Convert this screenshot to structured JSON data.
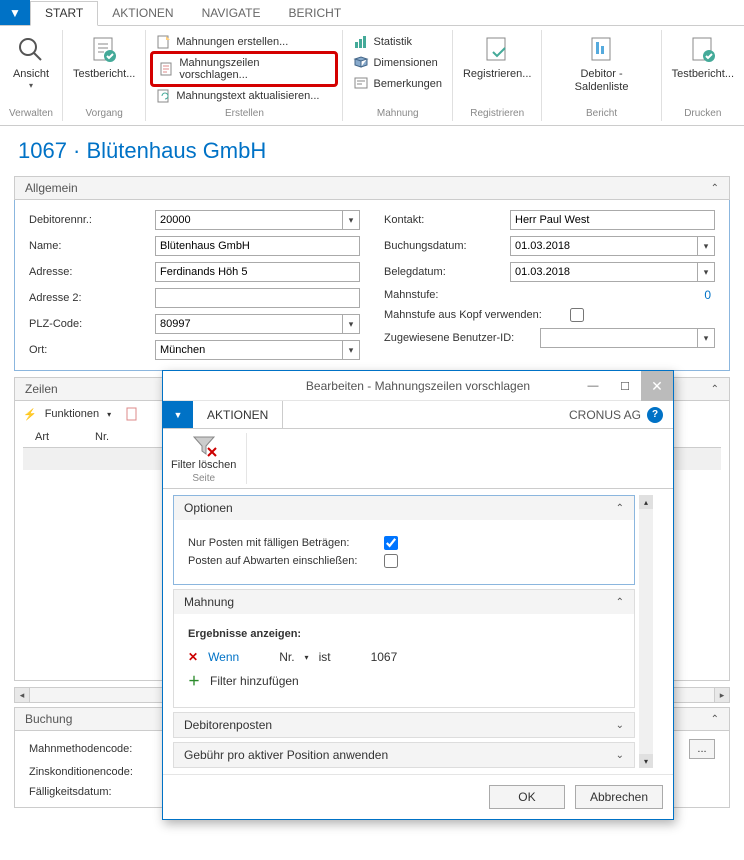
{
  "tabs": {
    "file_dropdown": "▼",
    "start": "START",
    "aktionen": "AKTIONEN",
    "navigate": "NAVIGATE",
    "bericht": "BERICHT"
  },
  "ribbon": {
    "verwalten": {
      "label": "Verwalten",
      "ansicht": "Ansicht"
    },
    "vorgang": {
      "label": "Vorgang",
      "testbericht": "Testbericht..."
    },
    "erstellen": {
      "label": "Erstellen",
      "mahnungen_erstellen": "Mahnungen erstellen...",
      "mahnungszeilen_vorschlagen": "Mahnungszeilen vorschlagen...",
      "mahnungstext_aktualisieren": "Mahnungstext aktualisieren..."
    },
    "mahnung": {
      "label": "Mahnung",
      "statistik": "Statistik",
      "dimensionen": "Dimensionen",
      "bemerkungen": "Bemerkungen"
    },
    "registrieren": {
      "label": "Registrieren",
      "registrieren_btn": "Registrieren..."
    },
    "bericht_grp": {
      "label": "Bericht",
      "debitor_saldenliste": "Debitor - Saldenliste"
    },
    "drucken": {
      "label": "Drucken",
      "testbericht": "Testbericht..."
    }
  },
  "page": {
    "title": "1067 · Blütenhaus GmbH"
  },
  "allgemein": {
    "header": "Allgemein",
    "debitorennr_label": "Debitorennr.:",
    "debitorennr_value": "20000",
    "name_label": "Name:",
    "name_value": "Blütenhaus GmbH",
    "adresse_label": "Adresse:",
    "adresse_value": "Ferdinands Höh 5",
    "adresse2_label": "Adresse 2:",
    "adresse2_value": "",
    "plz_label": "PLZ-Code:",
    "plz_value": "80997",
    "ort_label": "Ort:",
    "ort_value": "München",
    "kontakt_label": "Kontakt:",
    "kontakt_value": "Herr Paul West",
    "buchungsdatum_label": "Buchungsdatum:",
    "buchungsdatum_value": "01.03.2018",
    "belegdatum_label": "Belegdatum:",
    "belegdatum_value": "01.03.2018",
    "mahnstufe_label": "Mahnstufe:",
    "mahnstufe_value": "0",
    "mahnstufe_kopf_label": "Mahnstufe aus Kopf verwenden:",
    "benutzerid_label": "Zugewiesene Benutzer-ID:"
  },
  "zeilen": {
    "header": "Zeilen",
    "funktionen": "Funktionen",
    "col_art": "Art",
    "col_nr": "Nr."
  },
  "buchung": {
    "header": "Buchung",
    "mahnmethodencode_label": "Mahnmethodencode:",
    "zinskonditionencode_label": "Zinskonditionencode:",
    "faelligkeitsdatum_label": "Fälligkeitsdatum:"
  },
  "dialog": {
    "title": "Bearbeiten - Mahnungszeilen vorschlagen",
    "tab_aktionen": "AKTIONEN",
    "company": "CRONUS AG",
    "filter_loeschen": "Filter löschen",
    "seite": "Seite",
    "optionen": {
      "header": "Optionen",
      "nur_posten": "Nur Posten mit fälligen Beträgen:",
      "posten_abwarten": "Posten auf Abwarten einschließen:"
    },
    "mahnung": {
      "header": "Mahnung",
      "ergebnisse": "Ergebnisse anzeigen:",
      "wenn": "Wenn",
      "nr": "Nr.",
      "ist": "ist",
      "value": "1067",
      "filter_hinzufuegen": "Filter hinzufügen"
    },
    "debitorenposten": "Debitorenposten",
    "gebuehr": "Gebühr pro aktiver Position anwenden",
    "ok": "OK",
    "abbrechen": "Abbrechen"
  }
}
